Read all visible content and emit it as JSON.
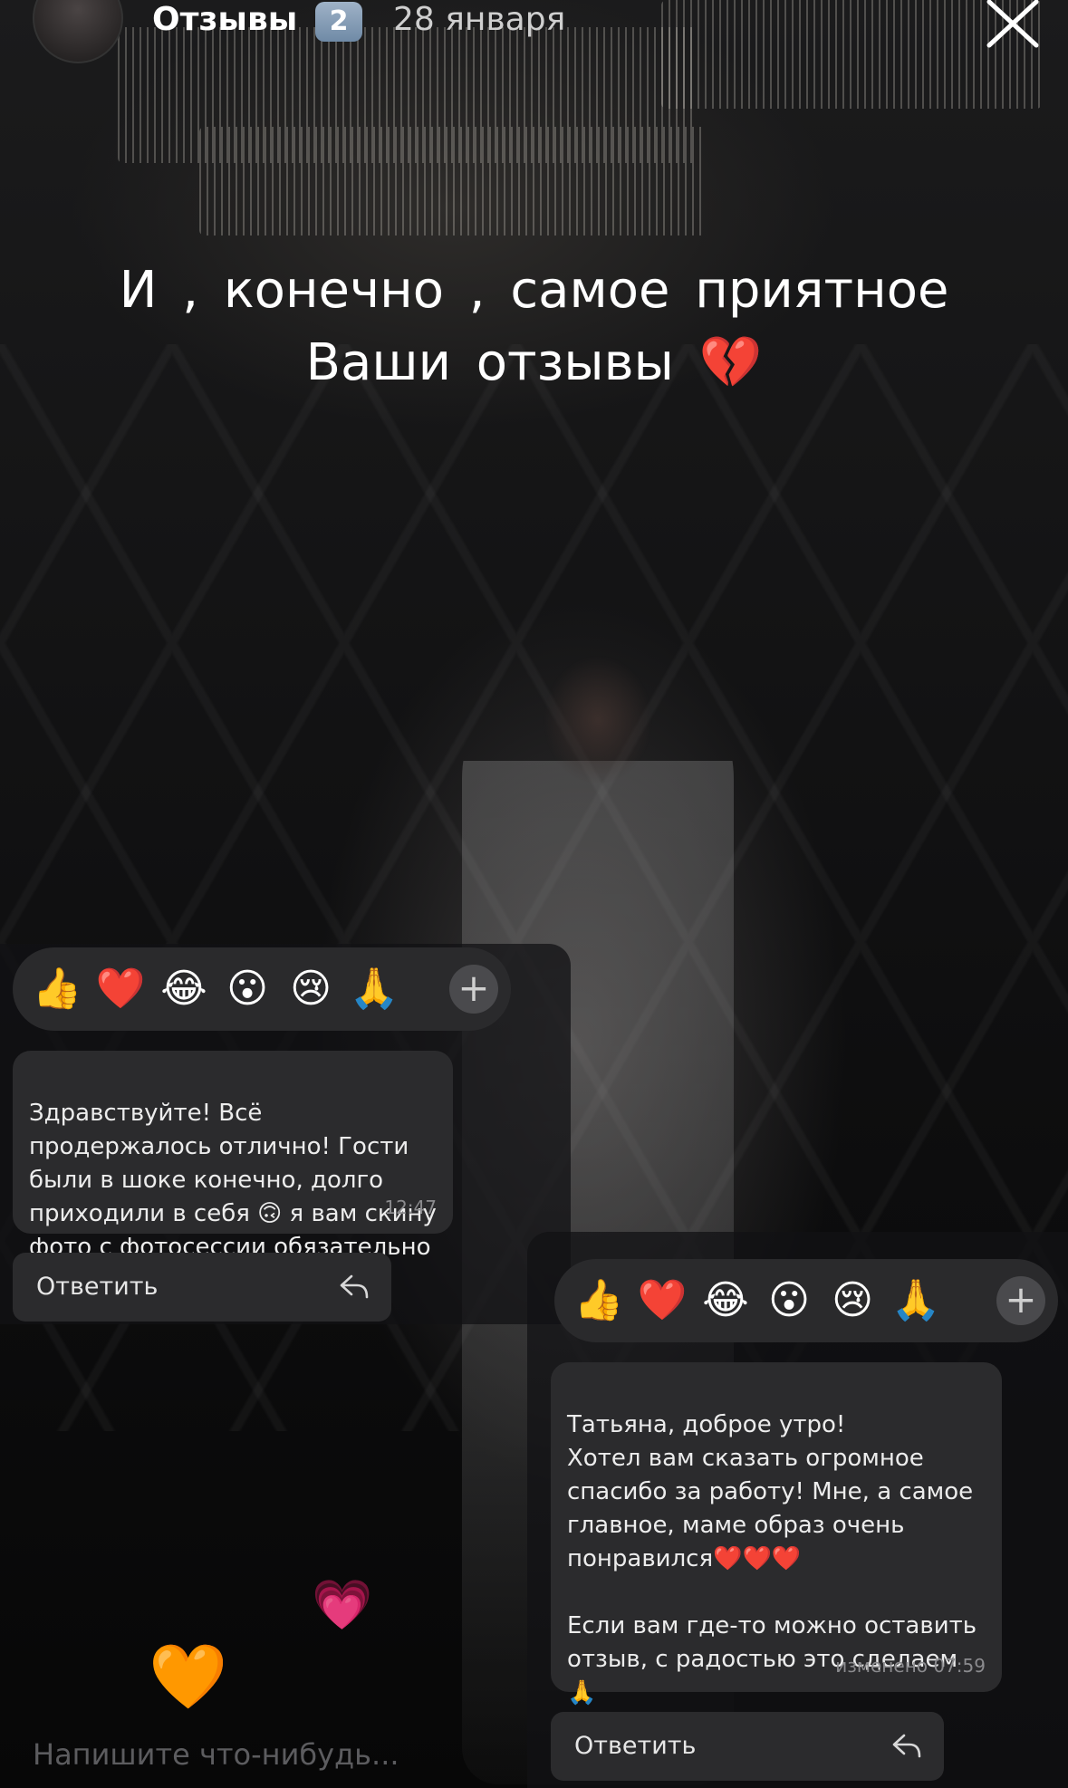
{
  "header": {
    "title": "Отзывы",
    "badge": "2",
    "date": "28 января"
  },
  "caption": {
    "line1": "И , конечно , самое приятное",
    "line2": "Ваши отзывы 💔"
  },
  "reactions": {
    "emojis": [
      "👍",
      "❤️",
      "😂",
      "😮",
      "😢",
      "🙏",
      "👏"
    ],
    "add_label": "+"
  },
  "messages": [
    {
      "text": "Здравствуйте! Всё продержалось отлично! Гости были в шоке конечно, долго приходили в себя 🙃 я вам скину фото с фотосессии обязательно",
      "time": "12:47",
      "reply_label": "Ответить"
    },
    {
      "text": "Татьяна, доброе утро!\nХотел вам сказать огромное спасибо за работу! Мне, а самое главное, маме образ очень понравился❤️❤️❤️\n\nЕсли вам где-то можно оставить отзыв, с радостью это сделаем 🙏",
      "time": "изменено 07:59",
      "reply_label": "Ответить"
    }
  ],
  "input": {
    "placeholder": "Напишите что-нибудь..."
  },
  "floating_hearts": [
    "💗",
    "🧡"
  ]
}
